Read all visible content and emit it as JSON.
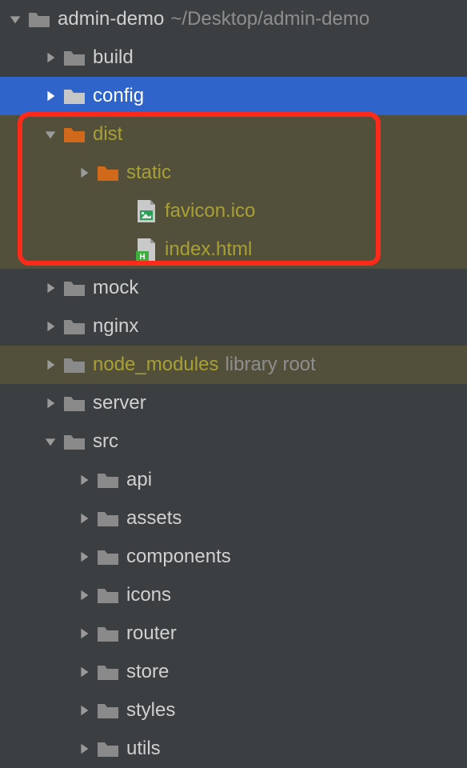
{
  "root": {
    "name": "admin-demo",
    "path": "~/Desktop/admin-demo"
  },
  "items": [
    {
      "name": "build"
    },
    {
      "name": "config"
    },
    {
      "name": "dist"
    },
    {
      "name": "static"
    },
    {
      "name": "favicon.ico"
    },
    {
      "name": "index.html"
    },
    {
      "name": "mock"
    },
    {
      "name": "nginx"
    },
    {
      "name": "node_modules",
      "hint": "library root"
    },
    {
      "name": "server"
    },
    {
      "name": "src"
    },
    {
      "name": "api"
    },
    {
      "name": "assets"
    },
    {
      "name": "components"
    },
    {
      "name": "icons"
    },
    {
      "name": "router"
    },
    {
      "name": "store"
    },
    {
      "name": "styles"
    },
    {
      "name": "utils"
    }
  ]
}
